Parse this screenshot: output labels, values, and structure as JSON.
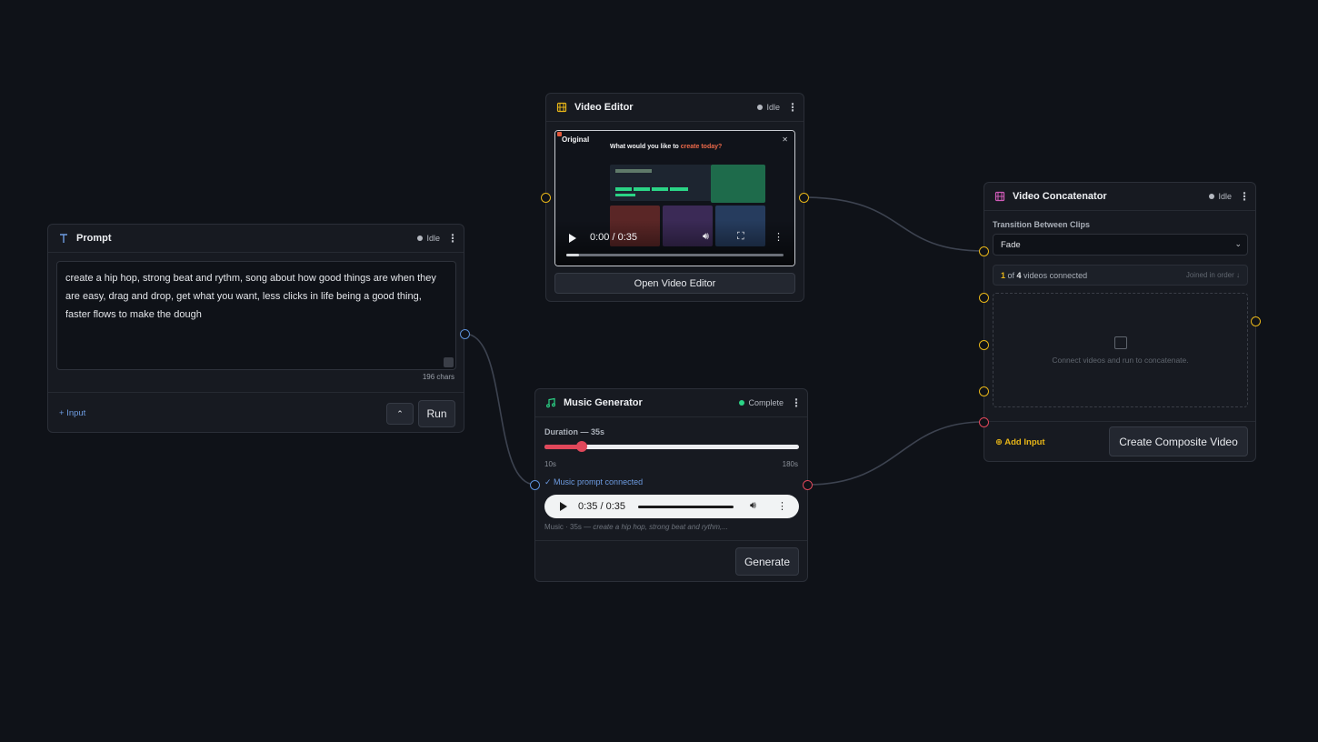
{
  "colors": {
    "background": "#0f1218",
    "node": "#171a21",
    "port_yellow": "#e7b518",
    "port_blue": "#5b8fd6",
    "port_red": "#e0475a",
    "status_complete": "#2bd486"
  },
  "prompt_node": {
    "icon": "text-t-icon",
    "title": "Prompt",
    "status": "Idle",
    "text": "create a hip hop, strong beat and rythm, song about how good things are when they are easy, drag and drop, get what you want, less clicks in life being a good thing, faster flows to make the dough",
    "char_count": "196 chars",
    "add_input": "+ Input",
    "collapse_icon": "chevron-up-icon",
    "run_label": "Run"
  },
  "video_editor_node": {
    "icon": "film-icon",
    "title": "Video Editor",
    "status": "Idle",
    "thumbnail_label": "Original",
    "thumbnail_heading_prefix": "What would you like to ",
    "thumbnail_heading_highlight": "create today?",
    "time": "0:00 / 0:35",
    "progress": 0.06,
    "open_label": "Open Video Editor"
  },
  "music_node": {
    "icon": "music-note-icon",
    "title": "Music Generator",
    "status": "Complete",
    "duration_label": "Duration — 35s",
    "duration_value": 35,
    "duration_min": 10,
    "duration_max": 180,
    "min_label": "10s",
    "max_label": "180s",
    "connected_note": "✓ Music prompt connected",
    "audio_time": "0:35 / 0:35",
    "audio_progress": 1.0,
    "caption_prefix": "Music · 35s — ",
    "caption_text": "create a hip hop, strong beat and rythm,...",
    "generate_label": "Generate"
  },
  "concat_node": {
    "icon": "film-icon",
    "title": "Video Concatenator",
    "status": "Idle",
    "transition_label": "Transition Between Clips",
    "transition_value": "Fade",
    "connected_count": "1",
    "connected_of": " of ",
    "connected_total": "4",
    "connected_suffix": " videos connected",
    "order_note": "Joined in order ↓",
    "empty_text": "Connect videos and run to concatenate.",
    "add_input": "Add Input",
    "create_label": "Create Composite Video"
  }
}
